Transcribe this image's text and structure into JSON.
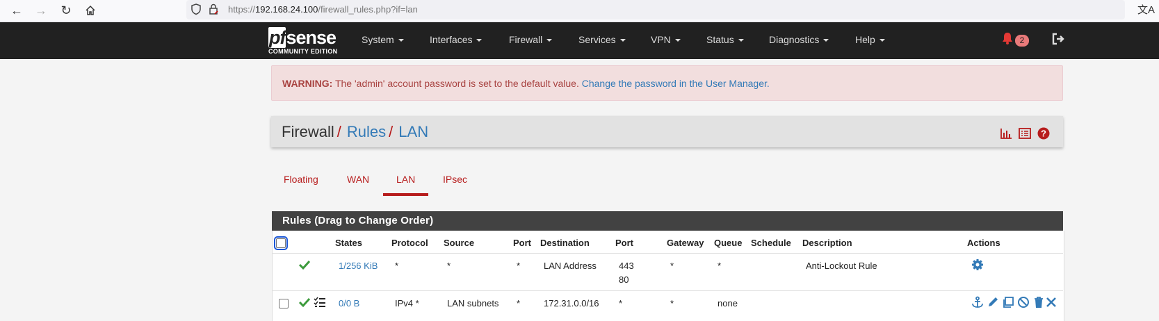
{
  "browser": {
    "url_prefix": "https://",
    "url_host": "192.168.24.100",
    "url_path": "/firewall_rules.php?if=lan"
  },
  "navbar": {
    "logo_main": "pfsense",
    "logo_pf": "pf",
    "logo_rest": "sense",
    "logo_sub": "COMMUNITY EDITION",
    "menus": [
      "System",
      "Interfaces",
      "Firewall",
      "Services",
      "VPN",
      "Status",
      "Diagnostics",
      "Help"
    ],
    "notification_count": "2"
  },
  "warning": {
    "label": "WARNING:",
    "text": " The 'admin' account password is set to the default value. ",
    "link": "Change the password in the User Manager."
  },
  "breadcrumb": {
    "root": "Firewall",
    "sep": "/",
    "rules": "Rules",
    "current": "LAN"
  },
  "tabs": [
    "Floating",
    "WAN",
    "LAN",
    "IPsec"
  ],
  "active_tab": "LAN",
  "rules": {
    "title": "Rules (Drag to Change Order)",
    "columns": [
      "States",
      "Protocol",
      "Source",
      "Port",
      "Destination",
      "Port",
      "Gateway",
      "Queue",
      "Schedule",
      "Description",
      "Actions"
    ],
    "rows": [
      {
        "states": "1/256 KiB",
        "protocol": "*",
        "source": "*",
        "port": "*",
        "destination": "LAN Address",
        "dest_port_1": "443",
        "dest_port_2": "80",
        "gateway": "*",
        "queue": "*",
        "schedule": "",
        "description": "Anti-Lockout Rule"
      },
      {
        "states": "0/0 B",
        "protocol": "IPv4 *",
        "source": "LAN subnets",
        "port": "*",
        "destination": "172.31.0.0/16",
        "dest_port_1": "*",
        "dest_port_2": "",
        "gateway": "*",
        "queue": "none",
        "schedule": "",
        "description": ""
      }
    ]
  },
  "colors": {
    "navbar": "#212121",
    "accent_red": "#b71c1c",
    "link_blue": "#337ab7",
    "pass_green": "#3c9b3c",
    "warning_bg": "#f2dede"
  }
}
